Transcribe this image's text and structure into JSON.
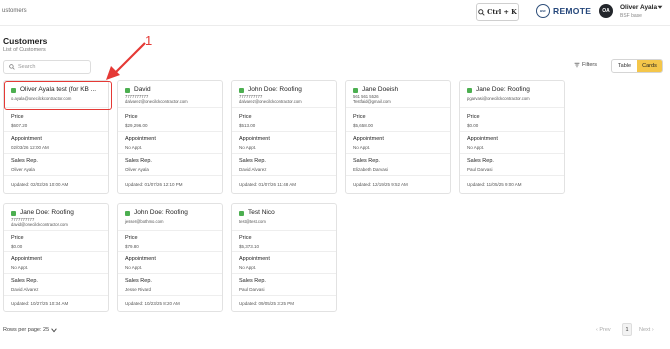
{
  "topbar": {
    "breadcrumb": "ustomers",
    "shortcut_label": "Ctrl + K",
    "brand_badge": "BSF",
    "brand_name": "REMOTE",
    "avatar_initials": "OA",
    "user_name": "Oliver Ayala",
    "user_sub": "BSF base"
  },
  "page": {
    "title": "Customers",
    "subtitle": "List of Customers"
  },
  "search": {
    "placeholder": "Search",
    "value": ""
  },
  "toolbar": {
    "filters_label": "Filters",
    "table_label": "Table",
    "cards_label": "Cards",
    "active_view": "Cards"
  },
  "labels": {
    "price": "Price",
    "appointment": "Appointment",
    "sales_rep": "Sales Rep."
  },
  "cards": [
    {
      "name": "Oliver Ayala test (for KB ...",
      "phone": "",
      "email": "o.ayala@onecilckcontractor.com",
      "price": "$607.20",
      "appointment": "02/03/26 12:00 AM",
      "sales_rep": "Oliver Ayala",
      "updated": "Updated: 02/02/26 10:00 AM"
    },
    {
      "name": "David",
      "phone": "7777777777",
      "email": "dalvarez@onecilckcontractor.com",
      "price": "$29,296.00",
      "appointment": "No Appt.",
      "sales_rep": "Oliver Ayala",
      "updated": "Updated: 01/07/26 12:10 PM"
    },
    {
      "name": "John Doe: Roofing",
      "phone": "7777777777",
      "email": "dalvarez@onecilckcontractor.com",
      "price": "$513.00",
      "appointment": "No Appt.",
      "sales_rep": "David Alvarez",
      "updated": "Updated: 01/07/26 11:48 AM"
    },
    {
      "name": "Jane Doeish",
      "phone": "561 561 5526",
      "email": "Testfaid@gmail.com",
      "price": "$5,658.00",
      "appointment": "No Appt.",
      "sales_rep": "Elizabeth Darvasi",
      "updated": "Updated: 12/19/25 9:52 AM"
    },
    {
      "name": "Jane Doe: Roofing",
      "phone": "",
      "email": "pgarvasi@onecilckcontractor.com",
      "price": "$0.00",
      "appointment": "No Appt.",
      "sales_rep": "Paul Darvasi",
      "updated": "Updated: 11/05/25 9:00 AM"
    },
    {
      "name": "Jane Doe: Roofing",
      "phone": "7777777777",
      "email": "david@onecilckcontractor.com",
      "price": "$0.00",
      "appointment": "No Appt.",
      "sales_rep": "David Alvarez",
      "updated": "Updated: 10/27/25 10:34 AM"
    },
    {
      "name": "John Doe: Roofing",
      "phone": "",
      "email": "jesser@bothmo.com",
      "price": "$79.80",
      "appointment": "No Appt.",
      "sales_rep": "Jesse Rivard",
      "updated": "Updated: 10/23/25 8:20 AM"
    },
    {
      "name": "Test Nico",
      "phone": "",
      "email": "test@test.com",
      "price": "$5,373.10",
      "appointment": "No Appt.",
      "sales_rep": "Paul Darvasi",
      "updated": "Updated: 09/05/25 3:25 PM"
    }
  ],
  "annotation": {
    "number": "1",
    "color": "#e53935"
  },
  "footer": {
    "rows_per_page": "Rows per page: 25",
    "prev": "‹ Prev",
    "current_page": "1",
    "next": "Next ›"
  },
  "colors": {
    "accent": "#f4c64a",
    "status_dot": "#4caf50",
    "brand": "#24467a"
  }
}
